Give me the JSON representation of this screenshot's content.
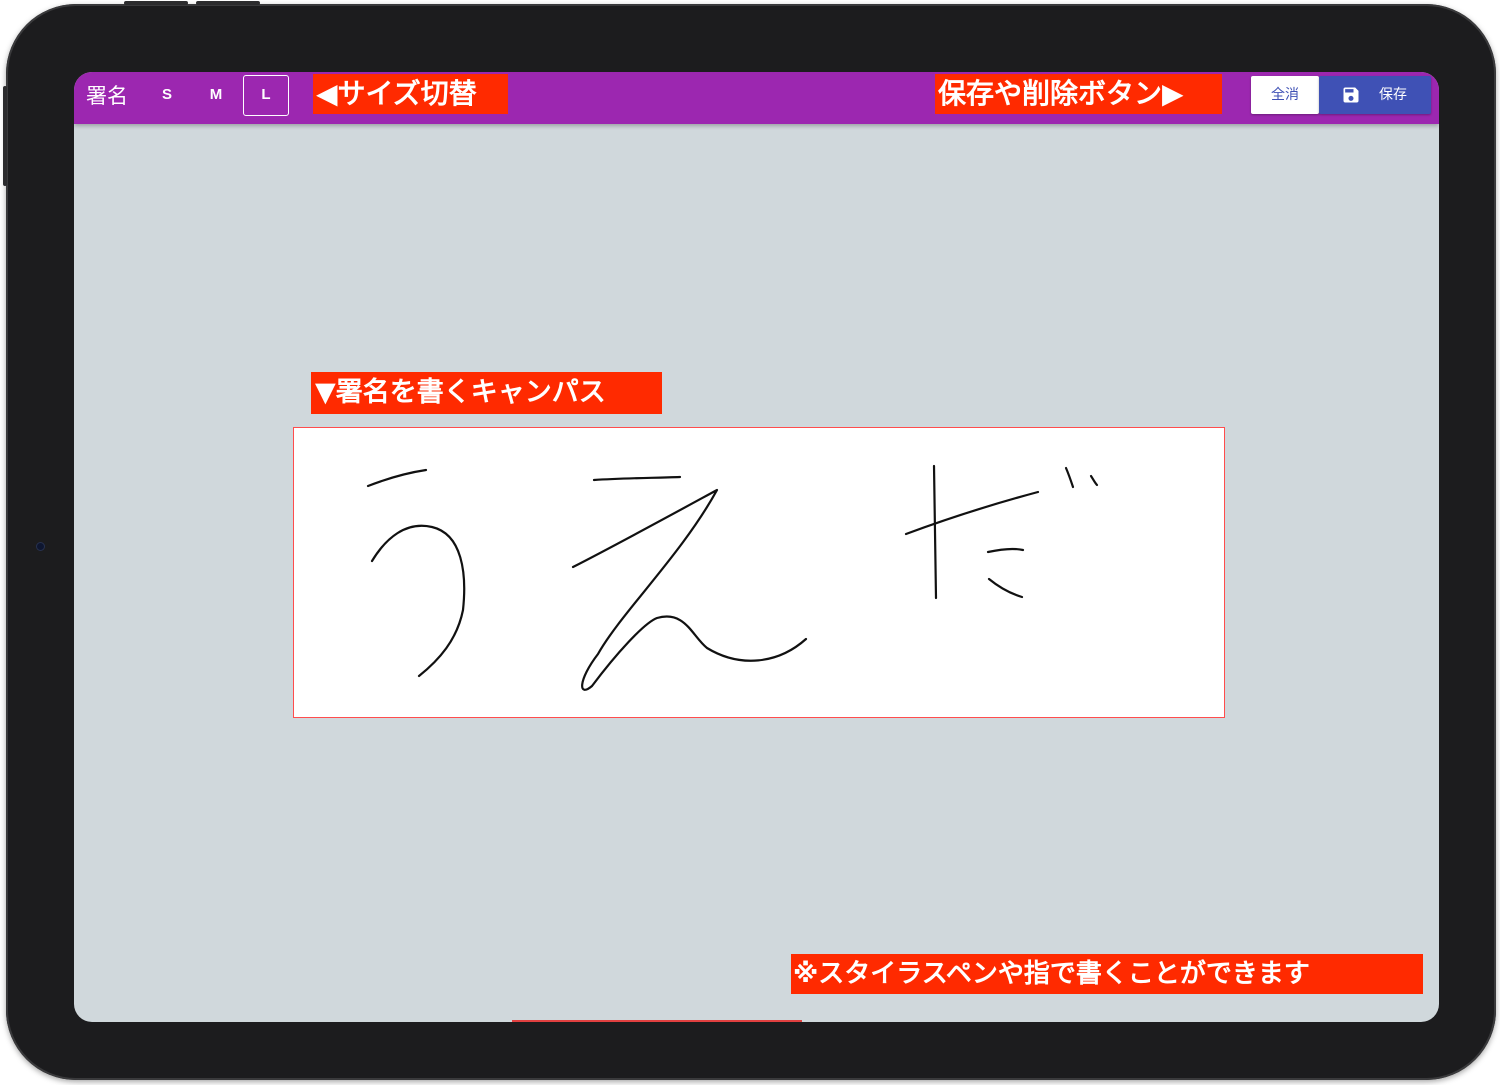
{
  "app": {
    "title": "署名"
  },
  "size_buttons": [
    {
      "label": "S",
      "active": false
    },
    {
      "label": "M",
      "active": false
    },
    {
      "label": "L",
      "active": true
    }
  ],
  "actions": {
    "clear_label": "全消",
    "save_label": "保存",
    "save_icon": "floppy-disk-icon"
  },
  "callouts": {
    "size_switch": "◀サイズ切替",
    "save_delete": "保存や削除ボタン▶",
    "canvas": "▼署名を書くキャンパス",
    "stylus_note": "※スタイラスペンや指で書くことができます"
  },
  "signature_canvas": {
    "handwritten_text": "うえだ"
  },
  "colors": {
    "toolbar": "#9c27b0",
    "save_button": "#3f51b5",
    "callout": "#ff2a00",
    "canvas_border": "#ff4d4d",
    "background": "#d0d8dc"
  }
}
